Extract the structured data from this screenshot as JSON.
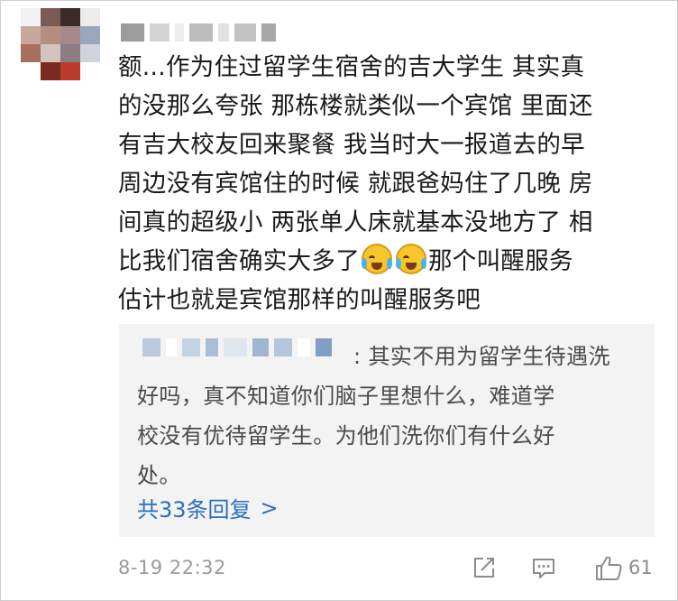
{
  "comment": {
    "lines": [
      "额...作为住过留学生宿舍的吉大学生 其实真",
      "的没那么夸张 那栋楼就类似一个宾馆 里面还",
      "有吉大校友回来聚餐 我当时大一报道去的早",
      "周边没有宾馆住的时候 就跟爸妈住了几晚 房",
      "间真的超级小 两张单人床就基本没地方了 相",
      "比我们宿舍确实大多了",
      "那个叫醒服务",
      "估计也就是宾馆那样的叫醒服务吧"
    ],
    "emoji": "laugh-cry-emoji"
  },
  "reply": {
    "lines": [
      ": 其实不用为留学生待遇洗",
      "好吗，真不知道你们脑子里想什么，难道学",
      "校没有优待留学生。为他们洗你们有什么好",
      "处。"
    ],
    "more_label": "共33条回复",
    "more_arrow": ">"
  },
  "footer": {
    "timestamp": "8-19 22:32",
    "like_count": "61"
  },
  "icons": {
    "share": "share-icon",
    "comment": "comment-icon",
    "like": "thumbs-up-icon"
  },
  "colors": {
    "link": "#2a6fbf",
    "reply_bg": "#f3f3f3",
    "meta": "#9a9a9a"
  }
}
